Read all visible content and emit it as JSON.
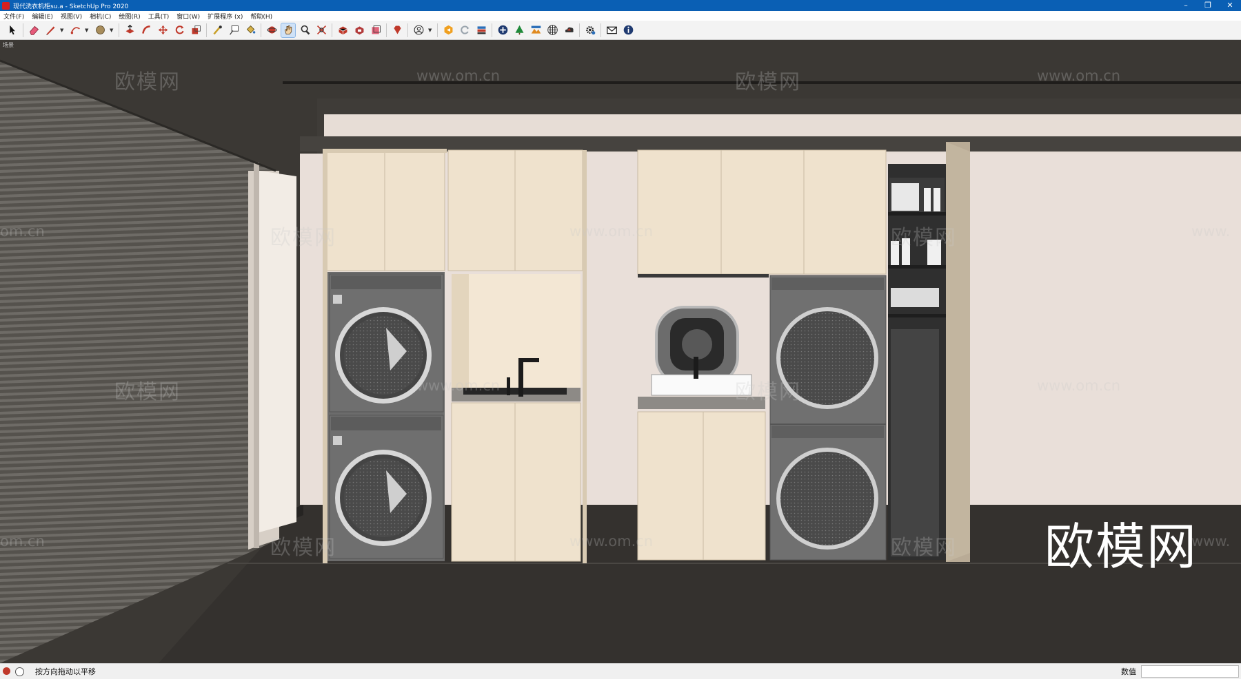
{
  "window": {
    "title": "现代洗衣机柜su.a - SketchUp Pro 2020"
  },
  "menu": [
    "文件(F)",
    "编辑(E)",
    "视图(V)",
    "相机(C)",
    "绘图(R)",
    "工具(T)",
    "窗口(W)",
    "扩展程序 (x)",
    "帮助(H)"
  ],
  "viewport": {
    "scene_label": "场景"
  },
  "watermarks": {
    "cn": "欧模网",
    "url": "www.om.cn",
    "url_cut_left": "om.cn",
    "url_cut_right": "www."
  },
  "brand_watermark": "欧模网",
  "status": {
    "message": "按方向拖动以平移",
    "value_label": "数值",
    "value": ""
  },
  "colors": {
    "titlebar": "#0a5fb4",
    "cabinet": "#efe2cd",
    "wall": "#e9dfd9",
    "appliance": "#6c6c6c"
  }
}
